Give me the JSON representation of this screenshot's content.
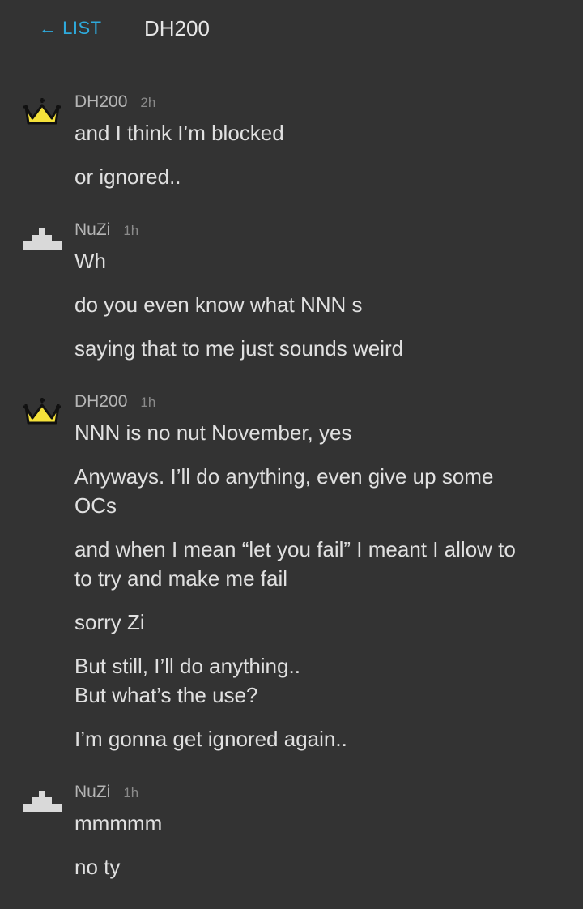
{
  "header": {
    "back_label": "← LIST",
    "title": "DH200"
  },
  "messages": [
    {
      "author": "DH200",
      "time": "2h",
      "avatar": "crown-icon",
      "lines": [
        "and I think I’m blocked",
        "or ignored.."
      ]
    },
    {
      "author": "NuZi",
      "time": "1h",
      "avatar": "pyramid-icon",
      "lines": [
        "Wh",
        "do you even know what NNN s",
        "saying that to me just sounds weird"
      ]
    },
    {
      "author": "DH200",
      "time": "1h",
      "avatar": "crown-icon",
      "lines": [
        "NNN is no nut November, yes",
        "Anyways. I’ll do anything, even give up some\nOCs",
        "and when I mean “let you fail” I meant I allow to\nto try and make me fail",
        "sorry Zi",
        "But still, I’ll do anything..\nBut what’s the use?",
        "I’m gonna get ignored again.."
      ]
    },
    {
      "author": "NuZi",
      "time": "1h",
      "avatar": "pyramid-icon",
      "lines": [
        "mmmmm",
        "no ty"
      ]
    }
  ],
  "colors": {
    "background": "#333333",
    "link": "#2eaadc",
    "crown": "#f5e23a"
  }
}
